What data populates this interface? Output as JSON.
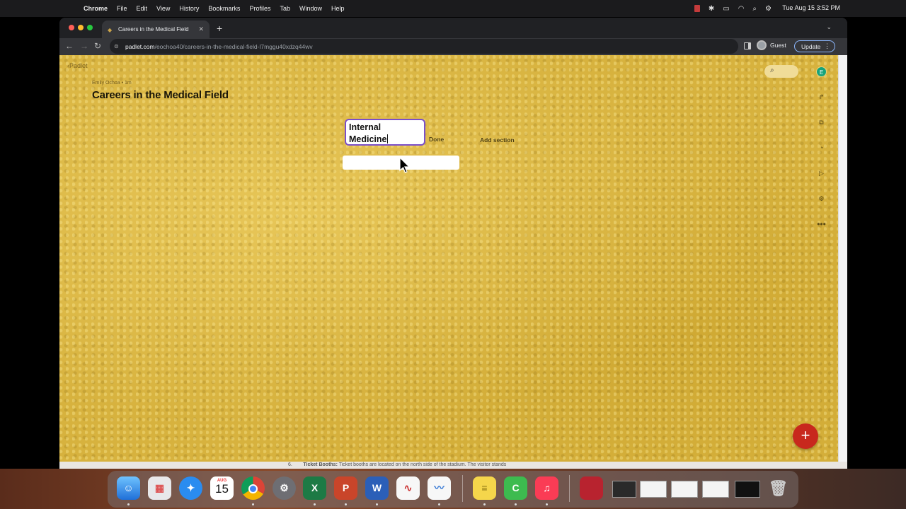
{
  "menubar": {
    "app_name": "Chrome",
    "items": [
      "File",
      "Edit",
      "View",
      "History",
      "Bookmarks",
      "Profiles",
      "Tab",
      "Window",
      "Help"
    ],
    "clock": "Tue Aug 15  3:52 PM"
  },
  "browser": {
    "tab_title": "Careers in the Medical Field",
    "new_tab_label": "+",
    "url_host": "padlet.com",
    "url_path": "/eochoa40/careers-in-the-medical-field-l7mggu40xdzq44wv",
    "profile_label": "Guest",
    "update_label": "Update"
  },
  "padlet": {
    "brand": "‹Padlet",
    "author": "Emily Ochoa • 1m",
    "title": "Careers in the Medical Field",
    "section_input_line1": "Internal",
    "section_input_line2": "Medicine",
    "done_label": "Done",
    "add_section_label": "Add section",
    "avatar_initial": "E",
    "fab_label": "+"
  },
  "doc_strip": {
    "number": "6.",
    "bold": "Ticket Booths:",
    "text": " Ticket booths are located on the north side of the stadium.  The visitor stands"
  },
  "dock": {
    "calendar_month": "AUG",
    "calendar_day": "15"
  },
  "colors": {
    "accent_purple": "#7b4fc9",
    "fab_red": "#c8281d",
    "padlet_gold": "#d7b23e",
    "avatar_green": "#16a37a"
  }
}
